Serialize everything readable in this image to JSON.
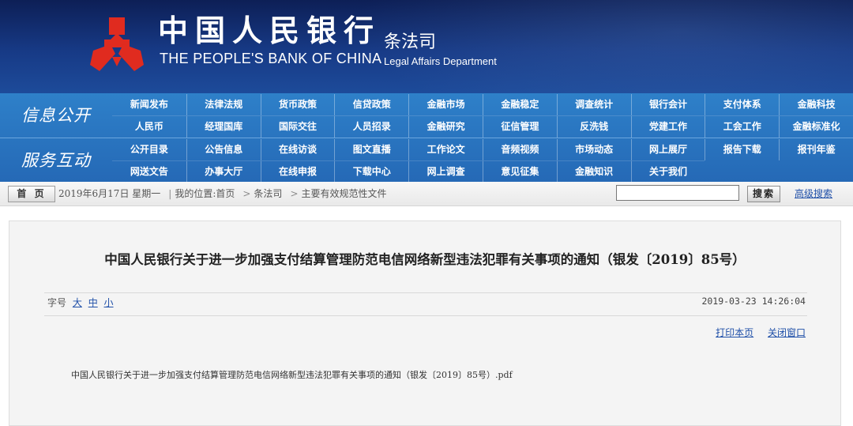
{
  "header": {
    "cn_name": "中国人民银行",
    "en_name": "THE PEOPLE'S BANK OF CHINA",
    "dept_cn": "条法司",
    "dept_en": "Legal Affairs Department",
    "logo_color": "#e02b1f"
  },
  "nav": {
    "groups": [
      {
        "title": "信息公开",
        "rows": [
          [
            "新闻发布",
            "法律法规",
            "货币政策",
            "信贷政策",
            "金融市场",
            "金融稳定",
            "调查统计",
            "银行会计",
            "支付体系",
            "金融科技"
          ],
          [
            "人民币",
            "经理国库",
            "国际交往",
            "人员招录",
            "金融研究",
            "征信管理",
            "反洗钱",
            "党建工作",
            "工会工作",
            "金融标准化"
          ]
        ]
      },
      {
        "title": "服务互动",
        "rows": [
          [
            "公开目录",
            "公告信息",
            "在线访谈",
            "图文直播",
            "工作论文",
            "音频视频",
            "市场动态",
            "网上展厅",
            "报告下载",
            "报刊年鉴"
          ],
          [
            "网送文告",
            "办事大厅",
            "在线申报",
            "下载中心",
            "网上调查",
            "意见征集",
            "金融知识",
            "关于我们"
          ]
        ]
      }
    ],
    "bg_color": "#2a73bf"
  },
  "location_bar": {
    "home": "首 页",
    "date": "2019年6月17日 星期一",
    "location_label": "我的位置:首页",
    "crumb_1": "条法司",
    "crumb_2": "主要有效规范性文件",
    "search_value": "",
    "search_button": "搜索",
    "advanced_search": "高级搜索"
  },
  "article": {
    "title": "中国人民银行关于进一步加强支付结算管理防范电信网络新型违法犯罪有关事项的通知（银发〔2019〕85号）",
    "font_size_label": "字号",
    "font_large": "大",
    "font_medium": "中",
    "font_small": "小",
    "date": "2019-03-23 14:26:04",
    "print": "打印本页",
    "close": "关闭窗口",
    "attachment": "中国人民银行关于进一步加强支付结算管理防范电信网络新型违法犯罪有关事项的通知（银发〔2019〕85号）.pdf"
  }
}
